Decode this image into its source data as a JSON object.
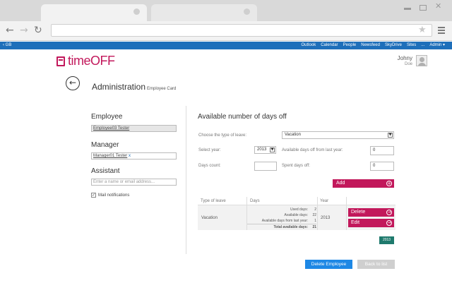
{
  "app": {
    "topbar_left": "‹ GB",
    "topbar_links": [
      "Outlook",
      "Calendar",
      "People",
      "Newsfeed",
      "SkyDrive",
      "Sites",
      "...",
      "Admin ▾"
    ],
    "logo_text": "timeOFF",
    "user_name": "Johny",
    "user_sub": "Doe",
    "brand_color": "#c2185b",
    "accent_color": "#1e6fba"
  },
  "page": {
    "title": "Administration",
    "subtitle": "Employee Card"
  },
  "left": {
    "employee_label": "Employee",
    "employee_value": "Employee03 Tester",
    "manager_label": "Manager",
    "manager_value": "Manager01 Tester",
    "manager_remove": "x",
    "assistant_label": "Assistant",
    "assistant_placeholder": "Enter a name or email address...",
    "mail_label": "Mail notifications",
    "mail_checked": true
  },
  "right": {
    "title": "Available number of days off",
    "type_label": "Choose the type of leave:",
    "type_value": "Vacation",
    "year_label": "Select year:",
    "year_value": "2013",
    "avail_last_label": "Available days off from last year:",
    "avail_last_value": "0",
    "count_label": "Days count:",
    "count_value": "",
    "spent_label": "Spent days off:",
    "spent_value": "0",
    "add_label": "Add"
  },
  "table": {
    "headers": [
      "Type of leave",
      "Days",
      "Year"
    ],
    "row": {
      "type": "Vacation",
      "year": "2013",
      "days": [
        {
          "label": "Used days:",
          "value": "2"
        },
        {
          "label": "Available days:",
          "value": "22"
        },
        {
          "label": "Available days from last year:",
          "value": "1"
        },
        {
          "label": "Total available days:",
          "value": "21"
        }
      ]
    },
    "delete_label": "Delete",
    "edit_label": "Edit",
    "year_badge": "2013"
  },
  "footer": {
    "delete_employee": "Delete Employee",
    "back_to_list": "Back to list"
  }
}
